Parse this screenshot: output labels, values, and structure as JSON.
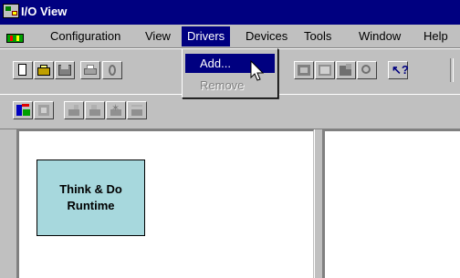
{
  "window": {
    "title": "I/O View"
  },
  "menu": {
    "items": [
      {
        "label": "Configuration"
      },
      {
        "label": "View"
      },
      {
        "label": "Drivers"
      },
      {
        "label": "Devices"
      },
      {
        "label": "Tools"
      },
      {
        "label": "Window"
      },
      {
        "label": "Help"
      }
    ],
    "active": "Drivers"
  },
  "drivers_menu": {
    "items": [
      {
        "label": "Add...",
        "enabled": true,
        "highlighted": true
      },
      {
        "label": "Remove",
        "enabled": false
      }
    ]
  },
  "canvas": {
    "node": {
      "line1": "Think & Do",
      "line2": "Runtime"
    }
  },
  "colors": {
    "titlebar": "#000080",
    "face": "#c0c0c0",
    "highlight": "#000080",
    "node_fill": "#bfe6ea"
  },
  "toolbar": {
    "row1_icons": [
      "new-icon",
      "open-icon",
      "save-icon",
      "print-icon",
      "cut-icon",
      "io-config-icon",
      "io-map-icon",
      "io-view-icon",
      "zoom-icon",
      "whats-this-icon"
    ],
    "row2_icons": [
      "add-driver-icon",
      "remove-driver-icon",
      "add-device-icon",
      "device-icon",
      "device-star-icon",
      "device-settings-icon"
    ]
  }
}
